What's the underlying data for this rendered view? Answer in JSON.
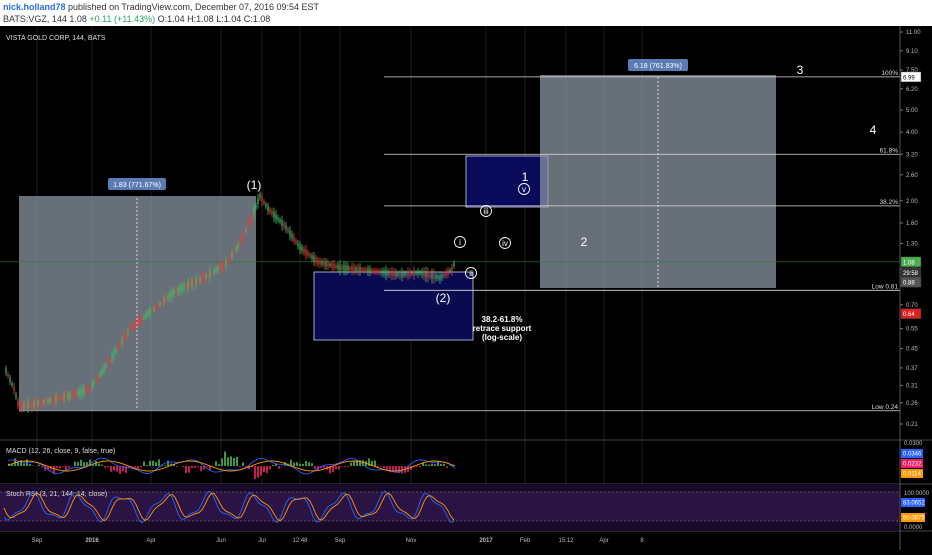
{
  "header": {
    "author": "nick.holland78",
    "published": " published on TradingView.com, December 07, 2016 09:54 EST",
    "symbol": "BATS:VGZ, 144",
    "last": "1.08",
    "change": "+0.11 (+11.43%)",
    "ohlc": "O:1.04 H:1.08 L:1.04 C:1.08"
  },
  "chart_data": {
    "type": "line",
    "title": "VISTA GOLD CORP, 144, BATS",
    "y_scale": "log",
    "y_ticks": [
      11.0,
      9.1,
      7.5,
      6.2,
      5.0,
      4.0,
      3.2,
      2.6,
      2.0,
      1.6,
      1.3,
      1.0,
      0.85,
      0.7,
      0.55,
      0.45,
      0.37,
      0.31,
      0.26,
      0.21
    ],
    "x_ticks": [
      "Sep",
      "2016",
      "Apr",
      "Jun",
      "Jul",
      "12:48",
      "Sep",
      "Nov",
      "2017",
      "Feb",
      "15:12",
      "Apr",
      "8"
    ],
    "price_tags": [
      {
        "value": 1.08,
        "label": "1.08",
        "color": "#4caf50"
      },
      {
        "value": 0.97,
        "label": "29:58",
        "color": "#333333"
      },
      {
        "value": 0.88,
        "label": "0.88",
        "color": "#555555"
      },
      {
        "value": 0.64,
        "label": "0.64",
        "color": "#e02020"
      },
      {
        "value": 6.99,
        "label": "6.99",
        "color": "#ffffff"
      }
    ],
    "fib_levels": [
      {
        "label": "100%",
        "value": 6.99
      },
      {
        "label": "61.8%",
        "value": 3.2
      },
      {
        "label": "38.2%",
        "value": 1.9
      },
      {
        "label": "Low 0.81",
        "value": 0.81
      },
      {
        "label": "Low 0.24",
        "value": 0.24
      }
    ],
    "measure_labels": [
      "1.83 (771.67%)",
      "6.18 (761.83%)"
    ],
    "annotations": {
      "waves": [
        "(1)",
        "(2)",
        "1",
        "2",
        "3",
        "4"
      ],
      "subwaves": [
        "i",
        "ii",
        "iii",
        "iv",
        "v"
      ],
      "retrace_note": [
        "38.2-61.8%",
        "retrace support",
        "(log-scale)"
      ]
    },
    "macd": {
      "label": "MACD (12, 26, close, 9, false, true)",
      "y_ticks": [
        "0.0300"
      ],
      "tags": [
        {
          "label": "0.0346",
          "color": "#2962ff"
        },
        {
          "label": "0.0232",
          "color": "#e91e63"
        },
        {
          "label": "0.0114",
          "color": "#ff9800"
        }
      ]
    },
    "stoch_rsi": {
      "label": "Stoch RSI (3, 21, 144, 14, close)",
      "y_ticks": [
        "100.0000",
        "0.0000"
      ],
      "tags": [
        {
          "label": "83.0652",
          "color": "#2962ff"
        },
        {
          "label": "50.0875",
          "color": "#ff9800"
        }
      ]
    }
  }
}
